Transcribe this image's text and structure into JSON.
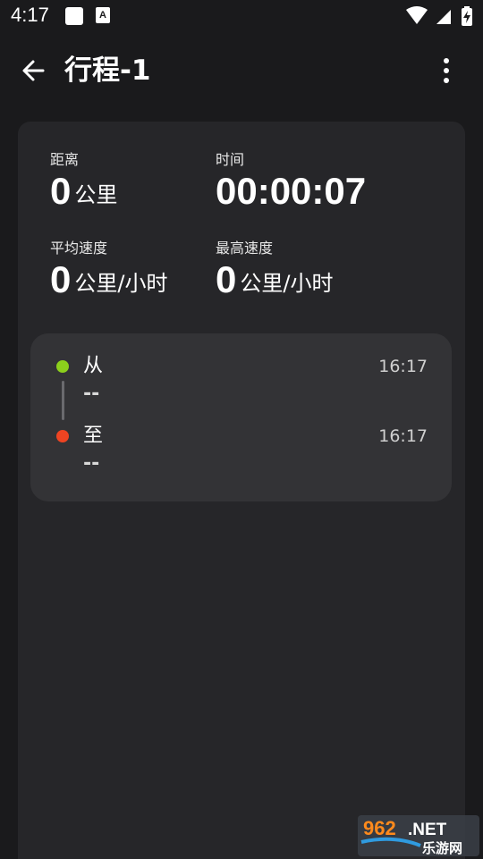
{
  "status_bar": {
    "time": "4:17",
    "notification_letter": "A",
    "icons": [
      "square-notification-icon",
      "a-notification-icon",
      "wifi-icon",
      "signal-icon",
      "battery-charging-icon"
    ]
  },
  "app_bar": {
    "title": "行程-1",
    "back_icon": "arrow-back-icon",
    "more_icon": "more-vert-icon"
  },
  "stats": {
    "distance": {
      "label": "距离",
      "value": "0",
      "unit": "公里"
    },
    "duration": {
      "label": "时间",
      "value": "00:00:07"
    },
    "avg_speed": {
      "label": "平均速度",
      "value": "0",
      "unit": "公里/小时"
    },
    "max_speed": {
      "label": "最高速度",
      "value": "0",
      "unit": "公里/小时"
    }
  },
  "route": {
    "from": {
      "label": "从",
      "place": "--",
      "time": "16:17",
      "color": "#8ccf1c"
    },
    "to": {
      "label": "至",
      "place": "--",
      "time": "16:17",
      "color": "#ee4422"
    }
  },
  "watermark": {
    "top_text": "962.NET",
    "bottom_text": "乐游网"
  },
  "colors": {
    "background": "#1a1a1c",
    "card": "#262629",
    "route_card": "#333336"
  }
}
